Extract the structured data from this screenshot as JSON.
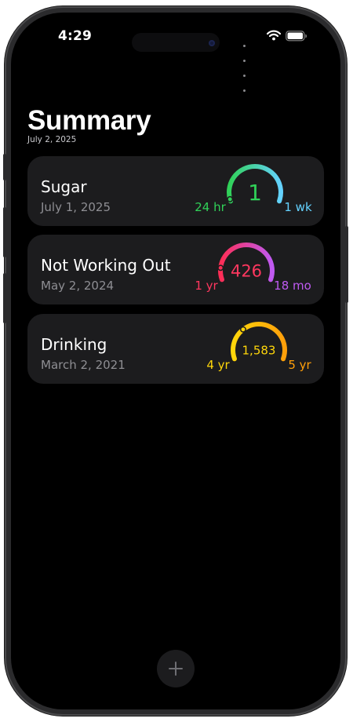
{
  "status_bar": {
    "time": "4:29",
    "wifi_icon": "wifi-icon",
    "battery_icon": "battery-icon"
  },
  "summary": {
    "title": "Summary",
    "date": "July 2, 2025"
  },
  "cards": [
    {
      "title": "Sugar",
      "date": "July 1, 2025",
      "count": "1",
      "left_label": "24 hr",
      "right_label": "1 wk",
      "progress": 0.02,
      "colors": {
        "start": "#30d158",
        "end": "#64d2ff",
        "count": "#30d158",
        "left_label": "#30d158",
        "right_label": "#64d2ff"
      }
    },
    {
      "title": "Not Working Out",
      "date": "May 2, 2024",
      "count": "426",
      "left_label": "1 yr",
      "right_label": "18 mo",
      "progress": 0.12,
      "colors": {
        "start": "#ff2d55",
        "end": "#bf5af2",
        "count": "#ff375f",
        "left_label": "#ff375f",
        "right_label": "#bf5af2"
      }
    },
    {
      "title": "Drinking",
      "date": "March 2, 2021",
      "count": "1,583",
      "left_label": "4 yr",
      "right_label": "5 yr",
      "progress": 0.33,
      "colors": {
        "start": "#ffd60a",
        "end": "#ff9f0a",
        "count": "#ffd60a",
        "left_label": "#ffd60a",
        "right_label": "#ff9f0a"
      }
    }
  ],
  "add_button": {
    "icon": "plus-icon"
  }
}
